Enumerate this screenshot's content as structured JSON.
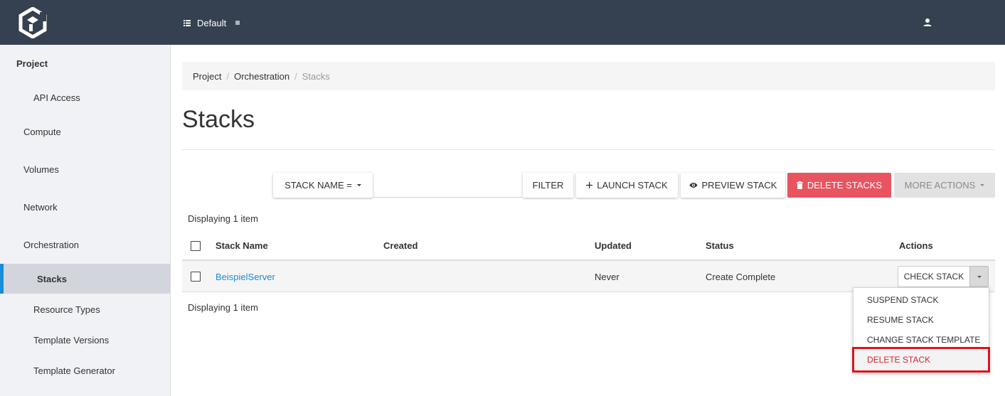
{
  "colors": {
    "topbar": "#354150",
    "sidebar_bg": "#f0f2f5",
    "active_indicator": "#1a8cd8",
    "link": "#1a8cd8",
    "danger_button": "#e85460",
    "danger_text": "#d9232d",
    "highlight_border": "#e0121b"
  },
  "topbar": {
    "logo_icon": "hexagon-logo-icon",
    "project_icon": "list-icon",
    "project_name": "Default",
    "user_icon": "user-icon"
  },
  "sidebar": {
    "items": [
      {
        "label": "Project",
        "type": "header"
      },
      {
        "label": "API Access",
        "type": "sub"
      },
      {
        "label": "Compute",
        "type": "group"
      },
      {
        "label": "Volumes",
        "type": "group"
      },
      {
        "label": "Network",
        "type": "group"
      },
      {
        "label": "Orchestration",
        "type": "group"
      },
      {
        "label": "Stacks",
        "type": "active"
      },
      {
        "label": "Resource Types",
        "type": "sub"
      },
      {
        "label": "Template Versions",
        "type": "sub"
      },
      {
        "label": "Template Generator",
        "type": "sub"
      }
    ]
  },
  "breadcrumb": [
    "Project",
    "Orchestration",
    "Stacks"
  ],
  "page_title": "Stacks",
  "toolbar": {
    "filter_field_label": "STACK NAME =",
    "filter_input_value": "",
    "filter_button": "FILTER",
    "launch_button": "LAUNCH STACK",
    "preview_button": "PREVIEW STACK",
    "delete_button": "DELETE STACKS",
    "more_actions_button": "MORE ACTIONS"
  },
  "table": {
    "count_text": "Displaying 1 item",
    "columns": [
      "Stack Name",
      "Created",
      "Updated",
      "Status",
      "Actions"
    ],
    "rows": [
      {
        "stack_name": "BeispielServer",
        "created": "",
        "updated": "Never",
        "status": "Create Complete",
        "action": "CHECK STACK"
      }
    ]
  },
  "row_actions_menu": {
    "items": [
      "SUSPEND STACK",
      "RESUME STACK",
      "CHANGE STACK TEMPLATE",
      "DELETE STACK"
    ],
    "highlighted": "DELETE STACK"
  }
}
